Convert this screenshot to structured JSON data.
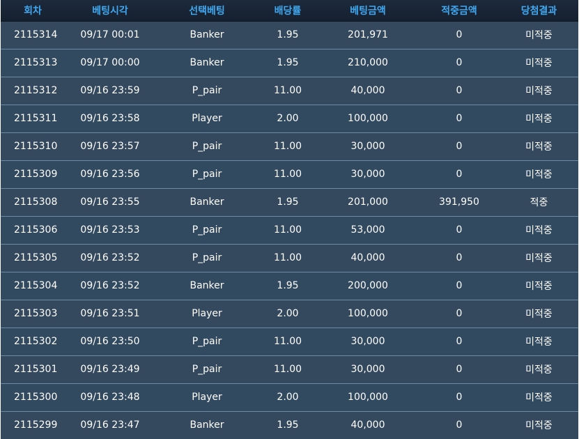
{
  "table": {
    "headers": [
      "회차",
      "베팅시각",
      "선택베팅",
      "배당률",
      "베팅금액",
      "적중금액",
      "당첨결과"
    ],
    "rows": [
      {
        "round": "2115314",
        "time": "09/17 00:01",
        "pick": "Banker",
        "odds": "1.95",
        "bet": "201,971",
        "win": "0",
        "result": "미적중",
        "status": "lose"
      },
      {
        "round": "2115313",
        "time": "09/17 00:00",
        "pick": "Banker",
        "odds": "1.95",
        "bet": "210,000",
        "win": "0",
        "result": "미적중",
        "status": "lose"
      },
      {
        "round": "2115312",
        "time": "09/16 23:59",
        "pick": "P_pair",
        "odds": "11.00",
        "bet": "40,000",
        "win": "0",
        "result": "미적중",
        "status": "lose"
      },
      {
        "round": "2115311",
        "time": "09/16 23:58",
        "pick": "Player",
        "odds": "2.00",
        "bet": "100,000",
        "win": "0",
        "result": "미적중",
        "status": "lose"
      },
      {
        "round": "2115310",
        "time": "09/16 23:57",
        "pick": "P_pair",
        "odds": "11.00",
        "bet": "30,000",
        "win": "0",
        "result": "미적중",
        "status": "lose"
      },
      {
        "round": "2115309",
        "time": "09/16 23:56",
        "pick": "P_pair",
        "odds": "11.00",
        "bet": "30,000",
        "win": "0",
        "result": "미적중",
        "status": "lose"
      },
      {
        "round": "2115308",
        "time": "09/16 23:55",
        "pick": "Banker",
        "odds": "1.95",
        "bet": "201,000",
        "win": "391,950",
        "result": "적중",
        "status": "win"
      },
      {
        "round": "2115306",
        "time": "09/16 23:53",
        "pick": "P_pair",
        "odds": "11.00",
        "bet": "53,000",
        "win": "0",
        "result": "미적중",
        "status": "lose"
      },
      {
        "round": "2115305",
        "time": "09/16 23:52",
        "pick": "P_pair",
        "odds": "11.00",
        "bet": "40,000",
        "win": "0",
        "result": "미적중",
        "status": "lose"
      },
      {
        "round": "2115304",
        "time": "09/16 23:52",
        "pick": "Banker",
        "odds": "1.95",
        "bet": "200,000",
        "win": "0",
        "result": "미적중",
        "status": "lose"
      },
      {
        "round": "2115303",
        "time": "09/16 23:51",
        "pick": "Player",
        "odds": "2.00",
        "bet": "100,000",
        "win": "0",
        "result": "미적중",
        "status": "lose"
      },
      {
        "round": "2115302",
        "time": "09/16 23:50",
        "pick": "P_pair",
        "odds": "11.00",
        "bet": "30,000",
        "win": "0",
        "result": "미적중",
        "status": "lose"
      },
      {
        "round": "2115301",
        "time": "09/16 23:49",
        "pick": "P_pair",
        "odds": "11.00",
        "bet": "30,000",
        "win": "0",
        "result": "미적중",
        "status": "lose"
      },
      {
        "round": "2115300",
        "time": "09/16 23:48",
        "pick": "Player",
        "odds": "2.00",
        "bet": "100,000",
        "win": "0",
        "result": "미적중",
        "status": "lose"
      },
      {
        "round": "2115299",
        "time": "09/16 23:47",
        "pick": "Banker",
        "odds": "1.95",
        "bet": "40,000",
        "win": "0",
        "result": "미적중",
        "status": "lose"
      }
    ]
  },
  "colors": {
    "header_bg": "#1a2535",
    "header_text": "#3fa8f0",
    "row_bg": "#34495e",
    "row_border": "#6d8aa5",
    "cell_text": "#ffffff",
    "lose_text": "#e8262a",
    "win_text": "#f0a030"
  }
}
